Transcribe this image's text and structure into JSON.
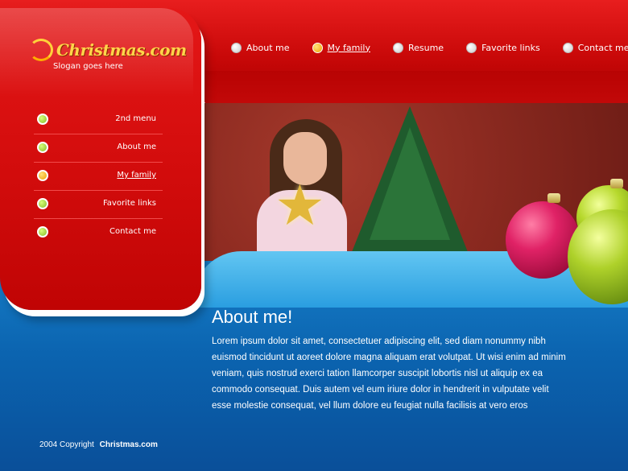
{
  "logo": {
    "name": "Christmas.com",
    "slogan": "Slogan goes here"
  },
  "top_nav": {
    "items": [
      {
        "label": "About me",
        "active": false
      },
      {
        "label": "My family",
        "active": true
      },
      {
        "label": "Resume",
        "active": false
      },
      {
        "label": "Favorite links",
        "active": false
      },
      {
        "label": "Contact me",
        "active": false
      }
    ]
  },
  "side_menu": {
    "items": [
      {
        "label": "2nd menu",
        "active": false
      },
      {
        "label": "About me",
        "active": false
      },
      {
        "label": "My family",
        "active": true
      },
      {
        "label": "Favorite links",
        "active": false
      },
      {
        "label": "Contact me",
        "active": false
      }
    ]
  },
  "content": {
    "title": "About me!",
    "body": " Lorem ipsum dolor sit amet, consectetuer adipiscing elit, sed diam nonummy  nibh euismod tincidunt ut aoreet dolore magna aliquam erat volutpat. Ut wisi enim ad minim veniam, quis nostrud exerci tation llamcorper suscipit lobortis nisl ut aliquip ex ea commodo consequat. Duis autem vel eum iriure dolor in hendrerit in vulputate velit esse molestie consequat, vel llum dolore eu feugiat nulla facilisis at vero eros"
  },
  "footer": {
    "copyright": "2004 Copyright",
    "brand": "Christmas.com"
  },
  "colors": {
    "red": "#d40d0d",
    "blue": "#1d8bd3",
    "gold": "#ffd54a"
  }
}
